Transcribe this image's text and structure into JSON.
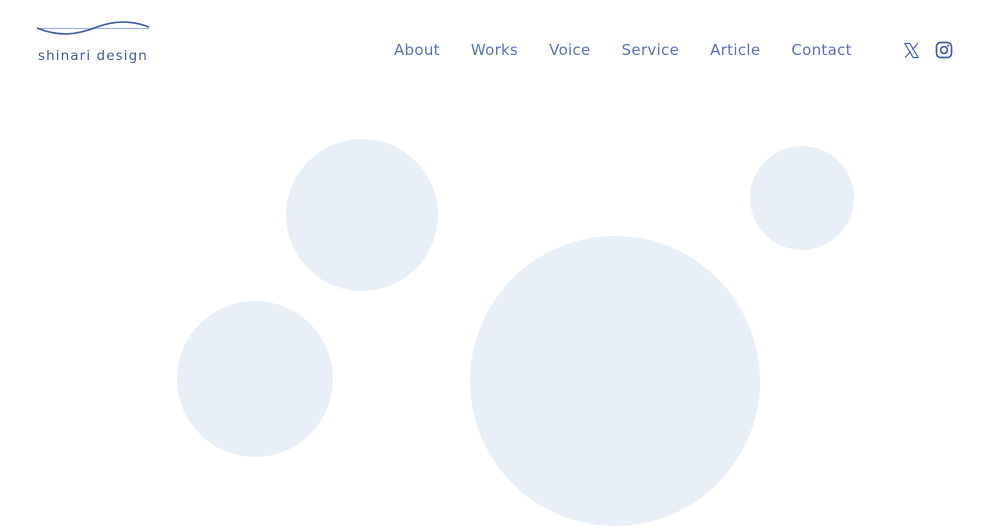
{
  "brand": {
    "name": "shinari design",
    "color": "#3f5b9c"
  },
  "nav": {
    "items": [
      {
        "label": "About"
      },
      {
        "label": "Works"
      },
      {
        "label": "Voice"
      },
      {
        "label": "Service"
      },
      {
        "label": "Article"
      },
      {
        "label": "Contact"
      }
    ],
    "color": "#5a72b5"
  },
  "social": {
    "icons": [
      "x-logo-icon",
      "instagram-icon"
    ]
  },
  "decor": {
    "circle_color": "#e8eff6"
  }
}
